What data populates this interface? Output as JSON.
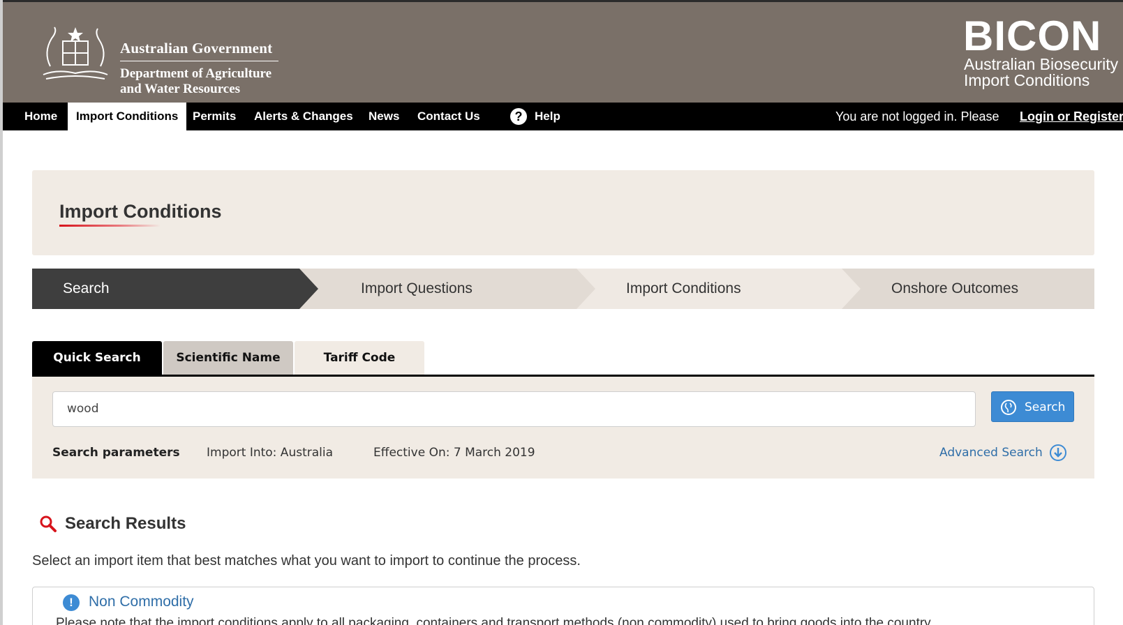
{
  "header": {
    "gov_title": "Australian Government",
    "dept_line1": "Department of Agriculture",
    "dept_line2": "and Water Resources",
    "app_name": "BICON",
    "app_sub1": "Australian Biosecurity",
    "app_sub2": "Import Conditions"
  },
  "nav": {
    "items": [
      {
        "label": "Home"
      },
      {
        "label": "Import Conditions"
      },
      {
        "label": "Permits"
      },
      {
        "label": "Alerts & Changes"
      },
      {
        "label": "News"
      },
      {
        "label": "Contact Us"
      },
      {
        "label": "Help"
      }
    ],
    "active": "Import Conditions",
    "login_text": "You are not logged in. Please",
    "login_link": "Login or Register"
  },
  "page": {
    "title": "Import Conditions"
  },
  "steps": [
    {
      "label": "Search",
      "active": true
    },
    {
      "label": "Import Questions",
      "active": false
    },
    {
      "label": "Import Conditions",
      "active": false
    },
    {
      "label": "Onshore Outcomes",
      "active": false
    }
  ],
  "search": {
    "tabs": [
      {
        "label": "Quick Search"
      },
      {
        "label": "Scientific Name"
      },
      {
        "label": "Tariff Code"
      }
    ],
    "active_tab": "Quick Search",
    "query": "wood",
    "button_label": "Search",
    "params_label": "Search parameters",
    "import_into": "Import Into: Australia",
    "effective_on": "Effective On: 7 March 2019",
    "advanced_label": "Advanced Search"
  },
  "results": {
    "title": "Search Results",
    "description": "Select an import item that best matches what you want to import to continue the process.",
    "cards": [
      {
        "title": "Non Commodity",
        "text": "Please note that the import conditions apply to all packaging, containers and transport methods (non commodity) used to bring goods into the country."
      }
    ]
  },
  "colors": {
    "header_bg": "#7a7068",
    "nav_bg": "#000000",
    "panel_bg": "#f1ebe4",
    "accent_blue": "#3d8bd4",
    "accent_red": "#d7131b"
  },
  "icons": {
    "crest": "coat-of-arms-icon",
    "help": "question-circle-icon",
    "search_button": "globe-search-icon",
    "advanced": "arrow-down-circle-icon",
    "results": "magnifier-icon",
    "notice": "exclamation-circle-icon"
  }
}
